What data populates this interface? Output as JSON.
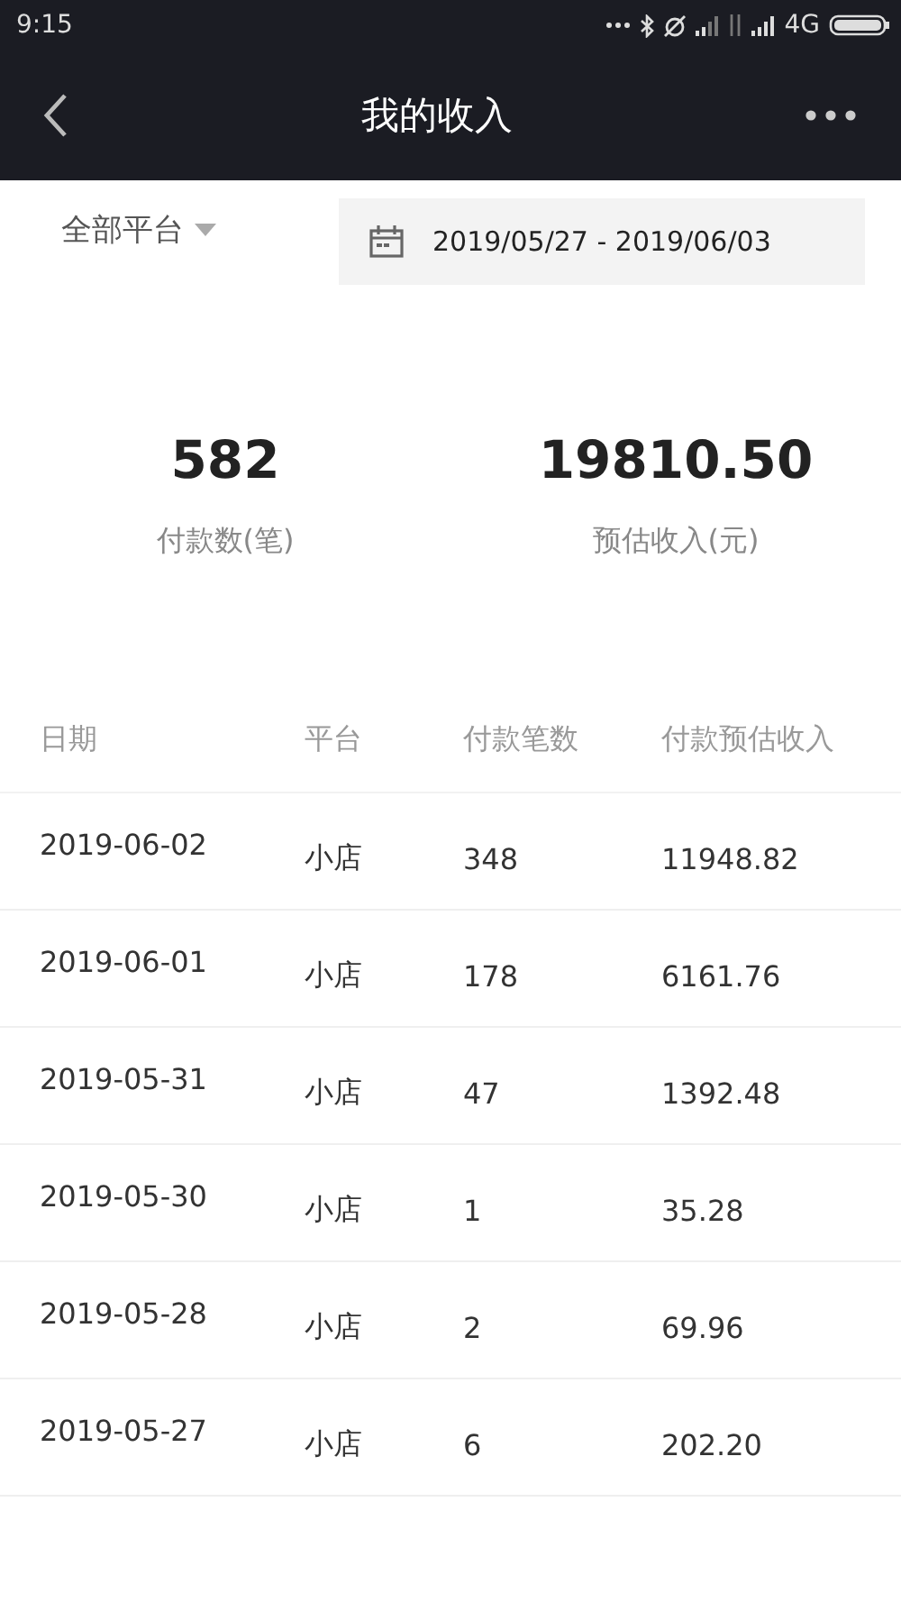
{
  "status_bar": {
    "time": "9:15",
    "network": "4G"
  },
  "header": {
    "title": "我的收入"
  },
  "filters": {
    "platform": "全部平台",
    "date_range": "2019/05/27 - 2019/06/03"
  },
  "summary": [
    {
      "value": "582",
      "label": "付款数(笔)"
    },
    {
      "value": "19810.50",
      "label": "预估收入(元)"
    }
  ],
  "table": {
    "columns": [
      "日期",
      "平台",
      "付款笔数",
      "付款预估收入"
    ],
    "rows": [
      [
        "2019-06-02",
        "小店",
        "348",
        "11948.82"
      ],
      [
        "2019-06-01",
        "小店",
        "178",
        "6161.76"
      ],
      [
        "2019-05-31",
        "小店",
        "47",
        "1392.48"
      ],
      [
        "2019-05-30",
        "小店",
        "1",
        "35.28"
      ],
      [
        "2019-05-28",
        "小店",
        "2",
        "69.96"
      ],
      [
        "2019-05-27",
        "小店",
        "6",
        "202.20"
      ]
    ]
  }
}
